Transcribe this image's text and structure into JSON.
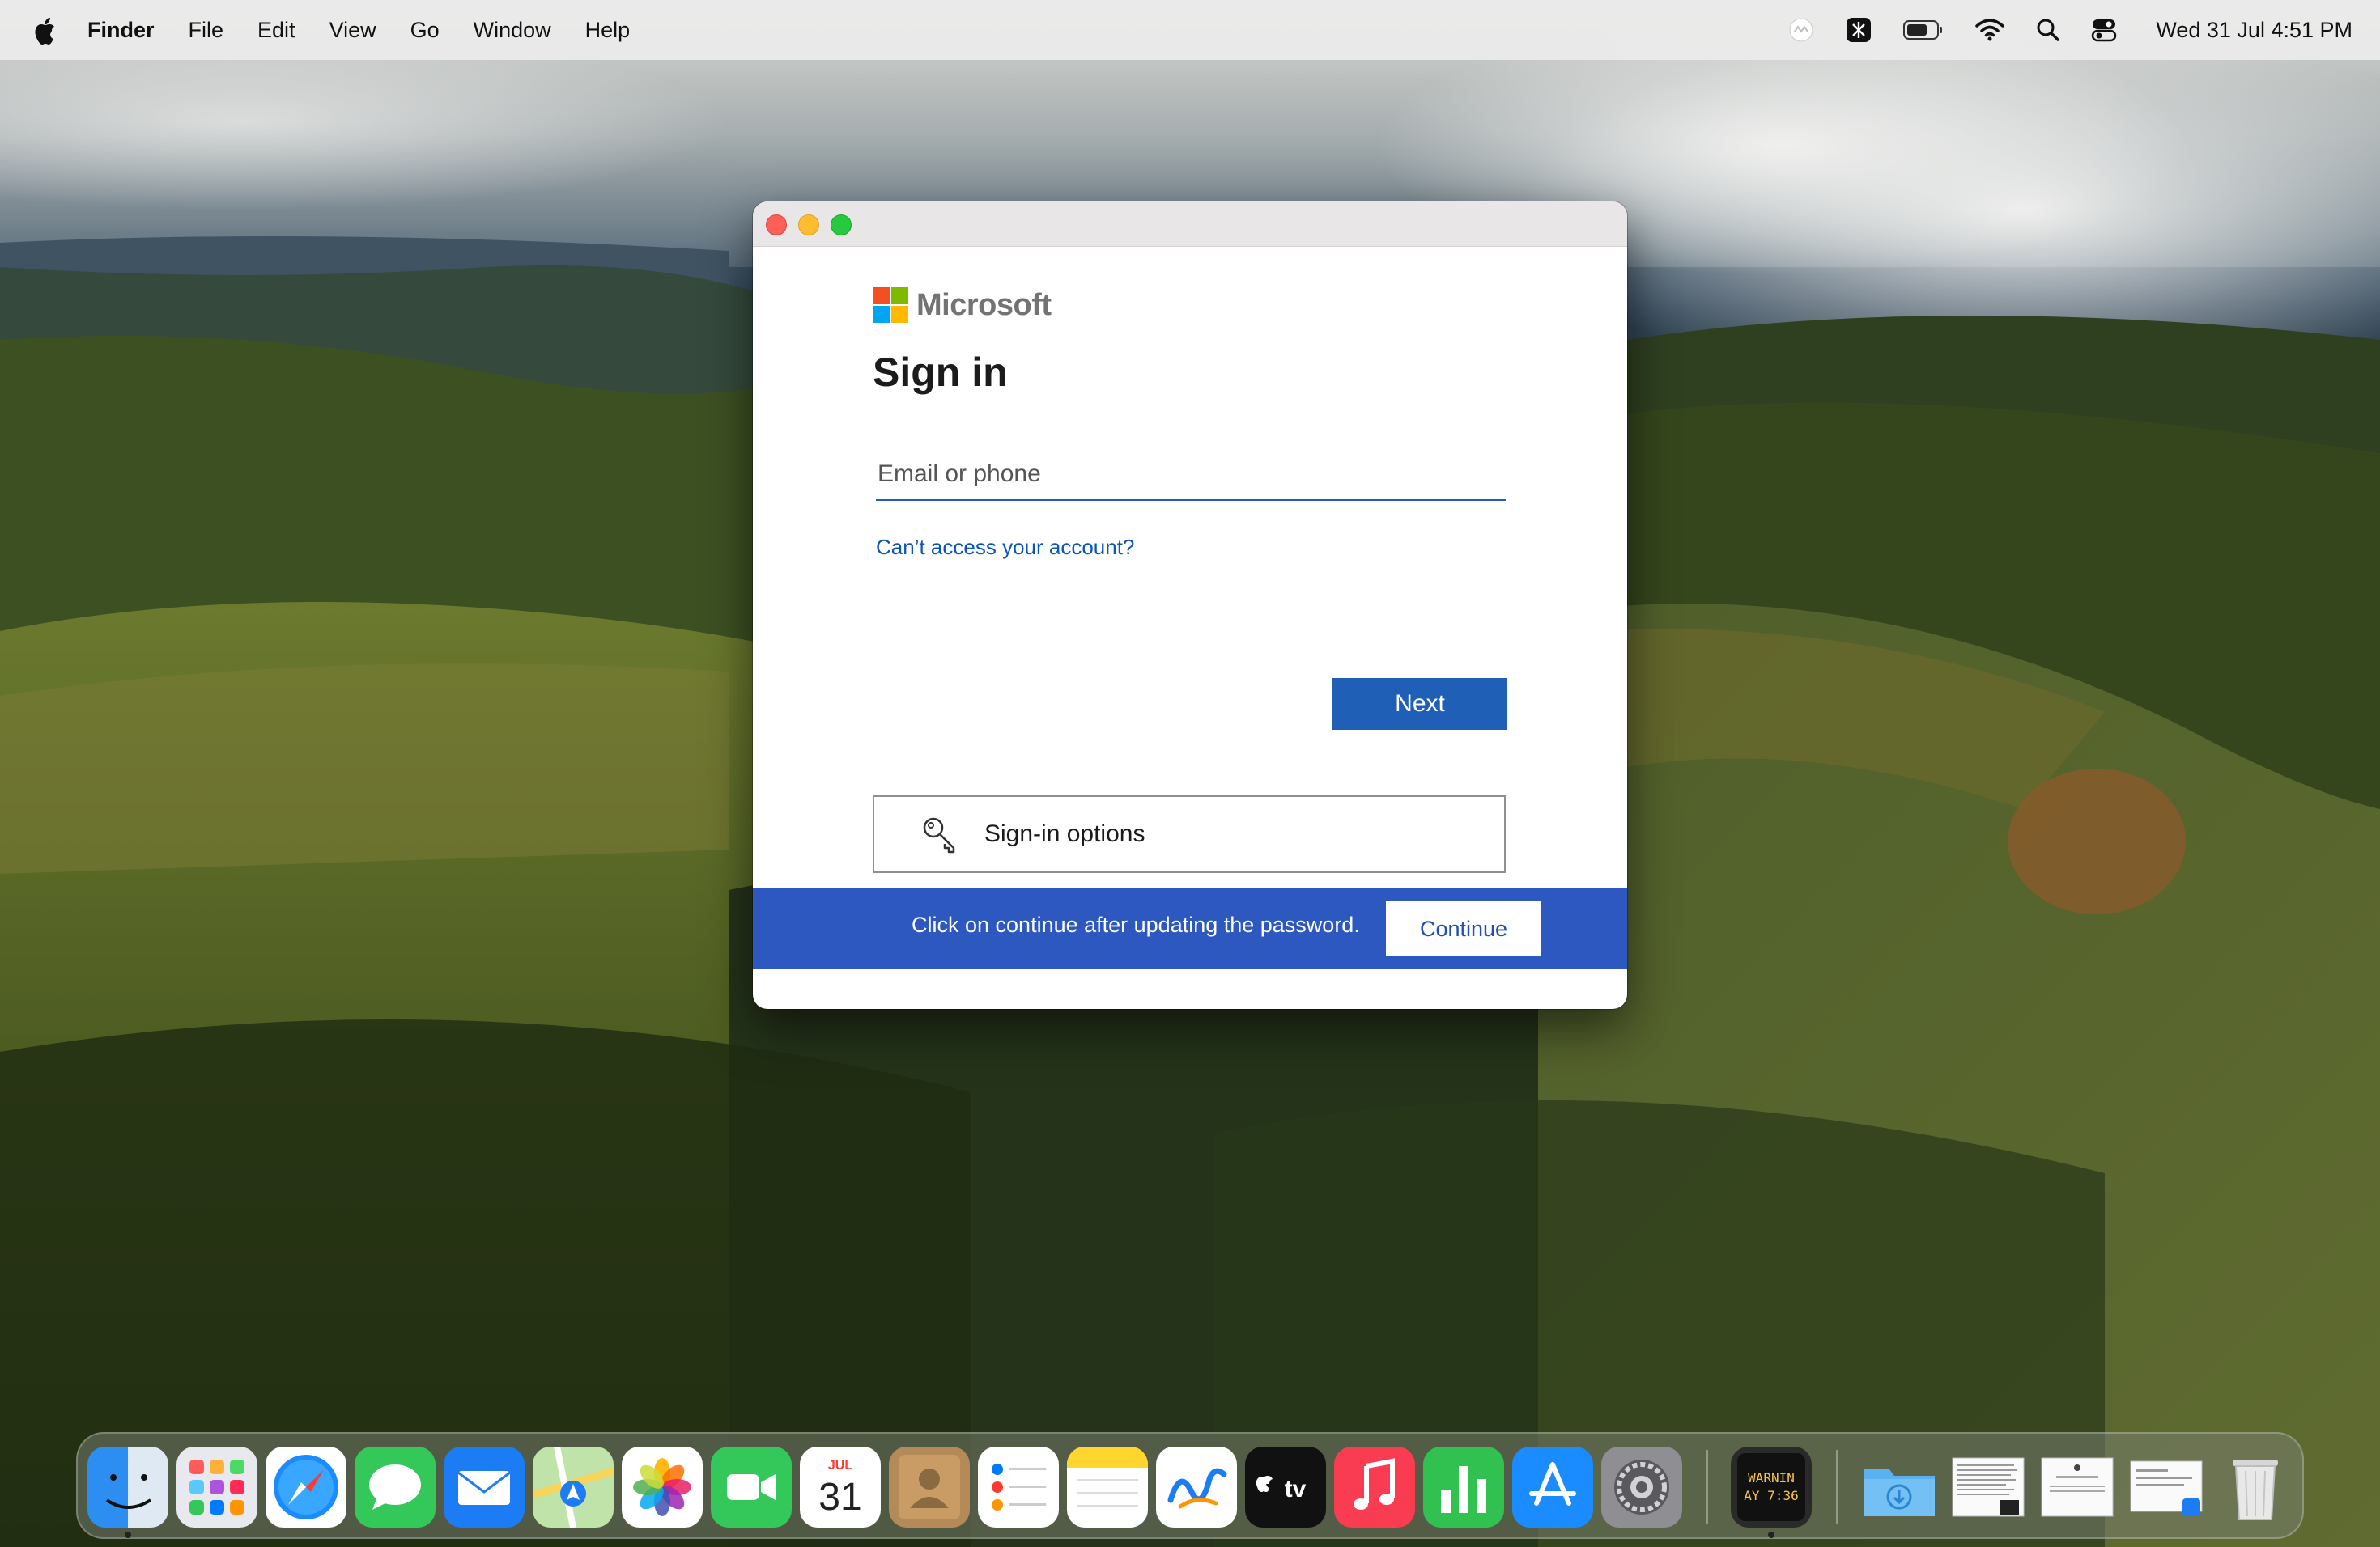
{
  "menubar": {
    "app_name": "Finder",
    "menus": [
      "File",
      "Edit",
      "View",
      "Go",
      "Window",
      "Help"
    ],
    "clock": "Wed 31 Jul  4:51 PM"
  },
  "signin": {
    "brand": "Microsoft",
    "heading": "Sign in",
    "email_placeholder": "Email or phone",
    "email_value": "",
    "cant_access_link": "Can’t access your account?",
    "next_label": "Next",
    "options_label": "Sign-in options",
    "banner_message": "Click on continue after updating the password.",
    "continue_label": "Continue"
  },
  "colors": {
    "accent": "#1f5fb5",
    "banner": "#2c58bf",
    "ms_red": "#f25022",
    "ms_green": "#7fba00",
    "ms_blue": "#00a4ef",
    "ms_yellow": "#ffb900"
  },
  "dock": {
    "calendar_month": "JUL",
    "calendar_day": "31",
    "console_text_1": "WARNIN",
    "console_text_2": "AY 7:36",
    "apps": [
      "finder-icon",
      "launchpad-icon",
      "safari-icon",
      "messages-icon",
      "mail-icon",
      "maps-icon",
      "photos-icon",
      "facetime-icon",
      "calendar-icon",
      "contacts-icon",
      "reminders-icon",
      "notes-icon",
      "freeform-icon",
      "apple-tv-icon",
      "music-icon",
      "numbers-icon",
      "app-store-icon",
      "system-settings-icon",
      "console-icon",
      "downloads-folder-icon",
      "document-thumbnail-icon",
      "document-thumbnail-icon",
      "document-thumbnail-icon",
      "trash-icon"
    ]
  }
}
